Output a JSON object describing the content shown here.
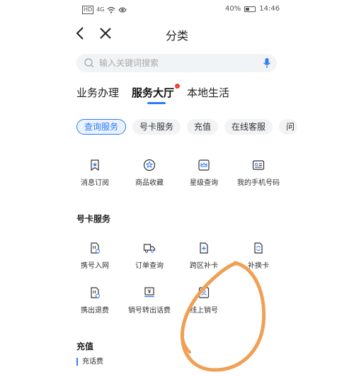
{
  "status_bar": {
    "battery": "40%",
    "time": "14:46",
    "left_icons": [
      "HD",
      "4G",
      "wifi-icon",
      "eye-icon"
    ]
  },
  "header": {
    "title": "分类"
  },
  "search": {
    "placeholder": "输入关键词搜索"
  },
  "tabs": [
    {
      "label": "业务办理",
      "active": false
    },
    {
      "label": "服务大厅",
      "active": true,
      "badge_dot": true
    },
    {
      "label": "本地生活",
      "active": false
    }
  ],
  "chips": [
    {
      "label": "查询服务",
      "active": true
    },
    {
      "label": "号卡服务",
      "active": false
    },
    {
      "label": "充值",
      "active": false
    },
    {
      "label": "在线客服",
      "active": false
    },
    {
      "label": "问",
      "active": false
    }
  ],
  "query_services": [
    {
      "label": "消息订阅",
      "icon": "bookmark-star-icon"
    },
    {
      "label": "商品收藏",
      "icon": "star-circle-icon"
    },
    {
      "label": "星级查询",
      "icon": "crown-icon"
    },
    {
      "label": "我的手机号码",
      "icon": "id-card-icon"
    }
  ],
  "number_card_section": {
    "title": "号卡服务"
  },
  "number_card_services": [
    {
      "label": "携号入网",
      "icon": "sim-transfer-icon"
    },
    {
      "label": "订单查询",
      "icon": "truck-icon"
    },
    {
      "label": "跨区补卡",
      "icon": "sim-plus-icon"
    },
    {
      "label": "补换卡",
      "icon": "sim-swap-icon"
    },
    {
      "label": "携出退费",
      "icon": "sim-refund-icon"
    },
    {
      "label": "销号转出话费",
      "icon": "yuan-transfer-icon"
    },
    {
      "label": "线上销号",
      "icon": "user-card-icon"
    }
  ],
  "recharge_section": {
    "title": "充值",
    "sub_label": "充话费"
  },
  "colors": {
    "accent": "#2d7df6",
    "badge": "#e8453c",
    "annotation": "#f0a055"
  }
}
